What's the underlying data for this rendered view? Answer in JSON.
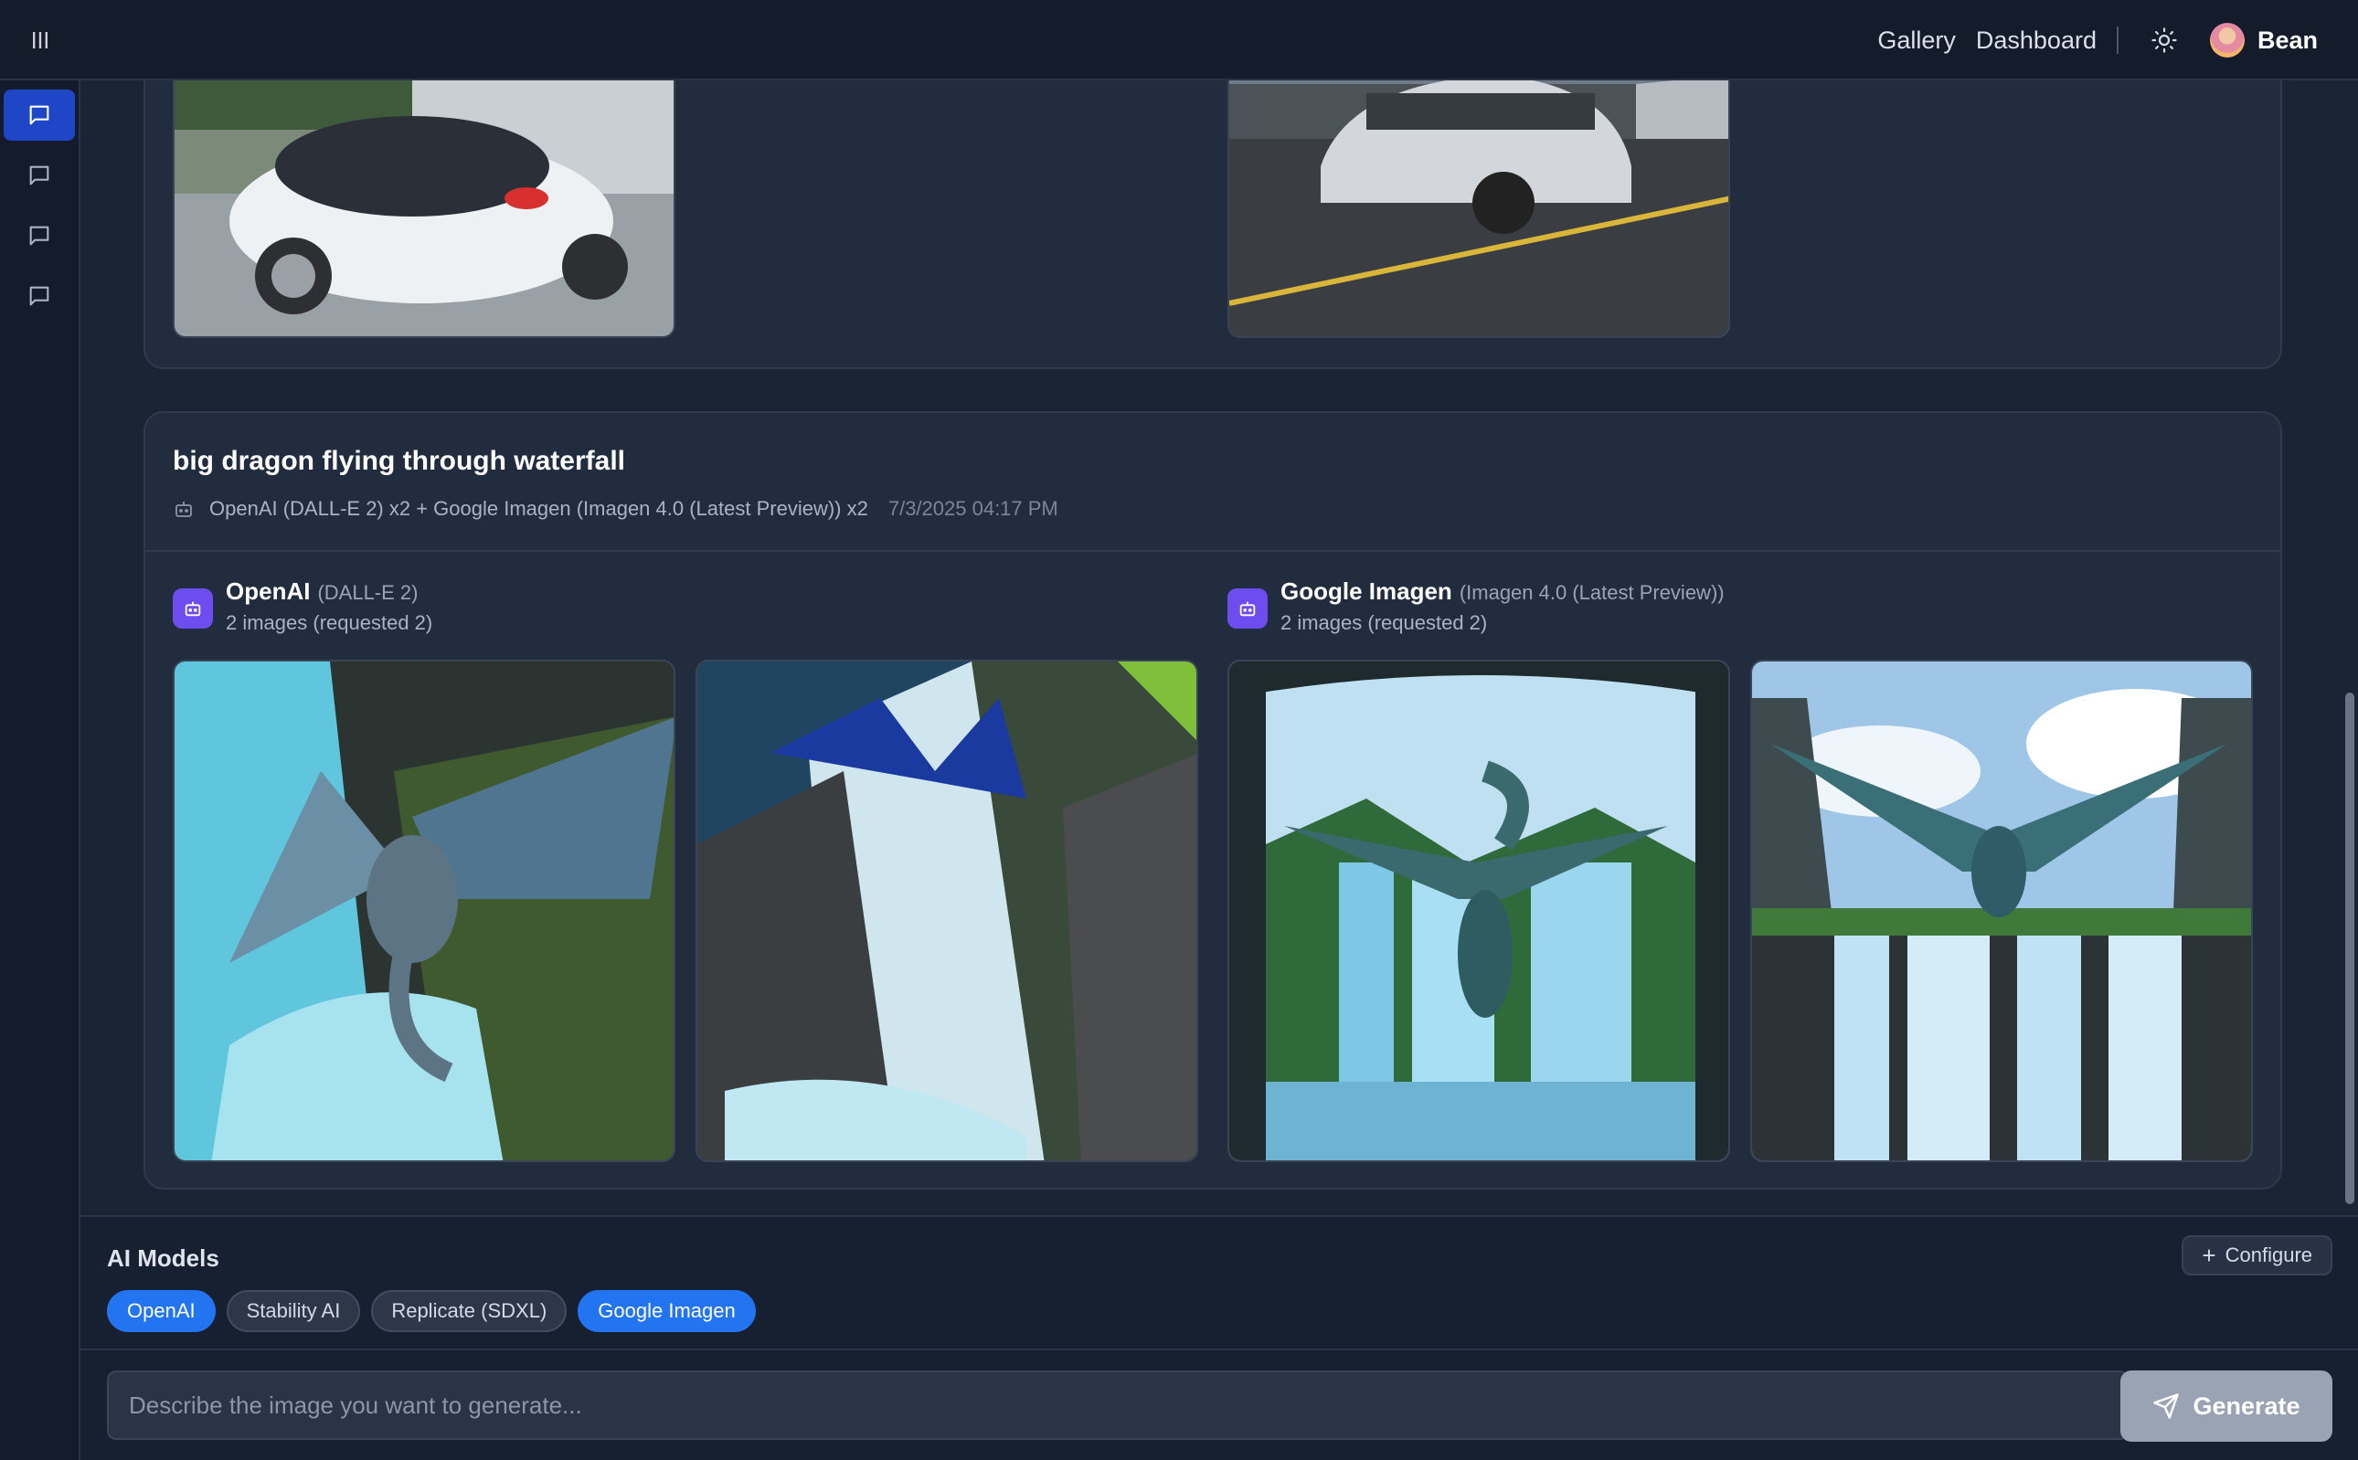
{
  "topbar": {
    "menu_icon": "sidebar-toggle-icon",
    "nav": [
      {
        "label": "Gallery"
      },
      {
        "label": "Dashboard"
      }
    ],
    "theme_icon": "sun-icon",
    "user_name": "Bean"
  },
  "sidebar": {
    "items": [
      {
        "icon": "chat-icon",
        "active": true
      },
      {
        "icon": "chat-icon",
        "active": false
      },
      {
        "icon": "chat-icon",
        "active": false
      },
      {
        "icon": "chat-icon",
        "active": false
      }
    ]
  },
  "generation": {
    "prompt": "big dragon flying through waterfall",
    "summary": "OpenAI (DALL-E 2) x2 + Google Imagen (Imagen 4.0 (Latest Preview)) x2",
    "timestamp": "7/3/2025 04:17 PM",
    "providers": [
      {
        "name": "OpenAI",
        "model": "(DALL-E 2)",
        "count": "2 images (requested 2)"
      },
      {
        "name": "Google Imagen",
        "model": "(Imagen 4.0 (Latest Preview))",
        "count": "2 images (requested 2)"
      }
    ]
  },
  "models_panel": {
    "title": "AI Models",
    "configure_label": "Configure",
    "chips": [
      {
        "label": "OpenAI",
        "selected": true
      },
      {
        "label": "Stability AI",
        "selected": false
      },
      {
        "label": "Replicate (SDXL)",
        "selected": false
      },
      {
        "label": "Google Imagen",
        "selected": true
      }
    ]
  },
  "composer": {
    "placeholder": "Describe the image you want to generate...",
    "value": "",
    "generate_label": "Generate"
  },
  "colors": {
    "accent": "#2374f0",
    "sidebar_active": "#1f46c7",
    "provider_badge": "#6d4cf0"
  }
}
